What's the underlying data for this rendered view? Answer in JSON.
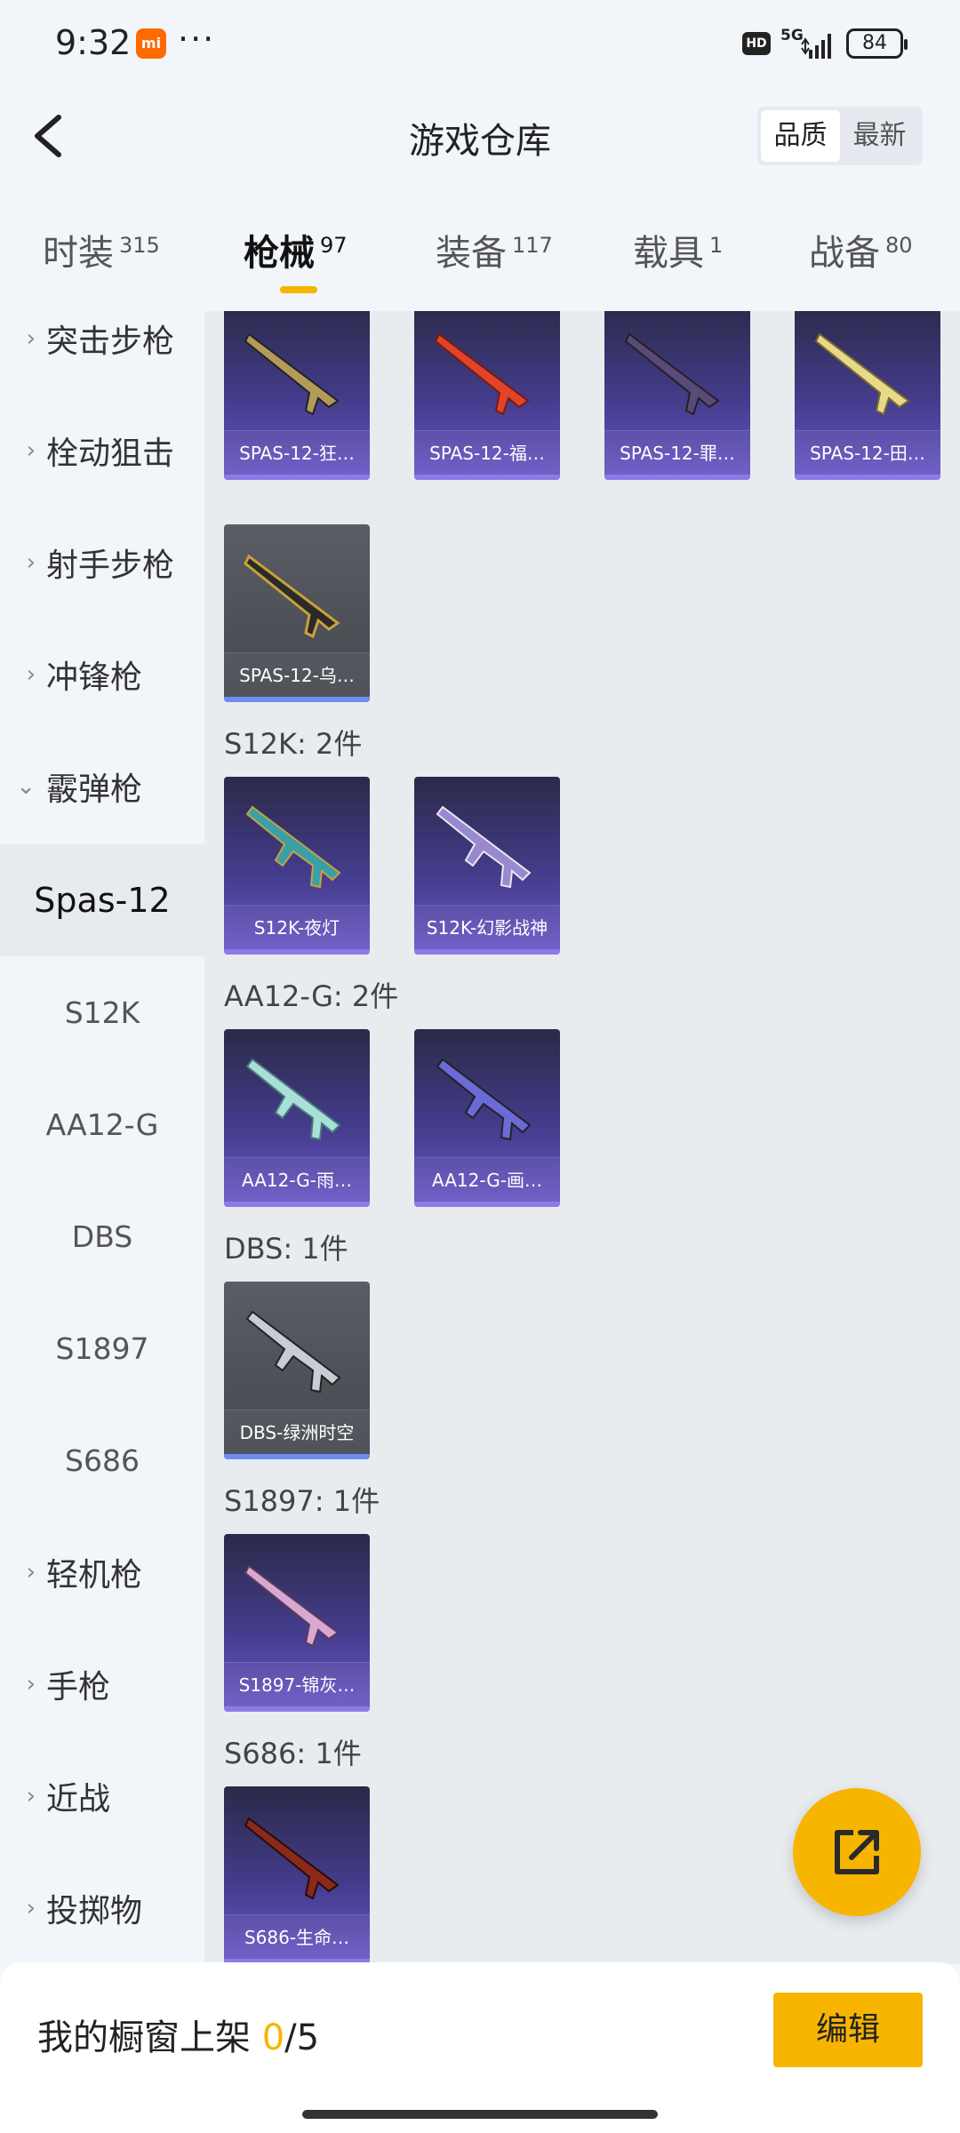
{
  "status_bar": {
    "time": "9:32",
    "brand_badge": "mi",
    "more": "···",
    "hd": "HD",
    "network": "5G",
    "battery": "84"
  },
  "header": {
    "title": "游戏仓库",
    "back_icon": "chevron-left-icon",
    "sort": {
      "quality": "品质",
      "latest": "最新",
      "active": "品质"
    }
  },
  "tabs": [
    {
      "label": "时装",
      "count": "315"
    },
    {
      "label": "枪械",
      "count": "97",
      "active": true
    },
    {
      "label": "装备",
      "count": "117"
    },
    {
      "label": "载具",
      "count": "1"
    },
    {
      "label": "战备",
      "count": "80"
    }
  ],
  "sidebar": {
    "chevron_right": "›",
    "chevron_down": "⌄",
    "items": [
      {
        "label": "突击步枪"
      },
      {
        "label": "栓动狙击"
      },
      {
        "label": "射手步枪"
      },
      {
        "label": "冲锋枪"
      },
      {
        "label": "霰弹枪",
        "expanded": true
      },
      {
        "label": "Spas-12",
        "sub": true,
        "selected": true
      },
      {
        "label": "S12K",
        "sub": true
      },
      {
        "label": "AA12-G",
        "sub": true
      },
      {
        "label": "DBS",
        "sub": true
      },
      {
        "label": "S1897",
        "sub": true
      },
      {
        "label": "S686",
        "sub": true
      },
      {
        "label": "轻机枪"
      },
      {
        "label": "手枪"
      },
      {
        "label": "近战"
      },
      {
        "label": "投掷物"
      }
    ]
  },
  "content": {
    "groups": [
      {
        "label": "",
        "items": [
          "SPAS-12-狂…",
          "SPAS-12-福…",
          "SPAS-12-罪…",
          "SPAS-12-田…",
          "SPAS-12-乌…"
        ]
      },
      {
        "label": "S12K: 2件",
        "items": [
          "S12K-夜灯",
          "S12K-幻影战神"
        ]
      },
      {
        "label": "AA12-G: 2件",
        "items": [
          "AA12-G-雨…",
          "AA12-G-画…"
        ]
      },
      {
        "label": "DBS: 1件",
        "items": [
          "DBS-绿洲时空"
        ]
      },
      {
        "label": "S1897: 1件",
        "items": [
          "S1897-锦灰…"
        ]
      },
      {
        "label": "S686: 1件",
        "items": [
          "S686-生命…"
        ]
      }
    ]
  },
  "fab": {
    "icon": "share-external-icon"
  },
  "bottom_bar": {
    "label_prefix": "我的橱窗上架 ",
    "current": "0",
    "total": "/5",
    "edit": "编辑"
  },
  "colors": {
    "accent": "#f7b500",
    "card_purple": "#443c8c",
    "card_gray": "#4d5056",
    "background": "#f2f5f9",
    "content_background": "#e9ecef"
  }
}
